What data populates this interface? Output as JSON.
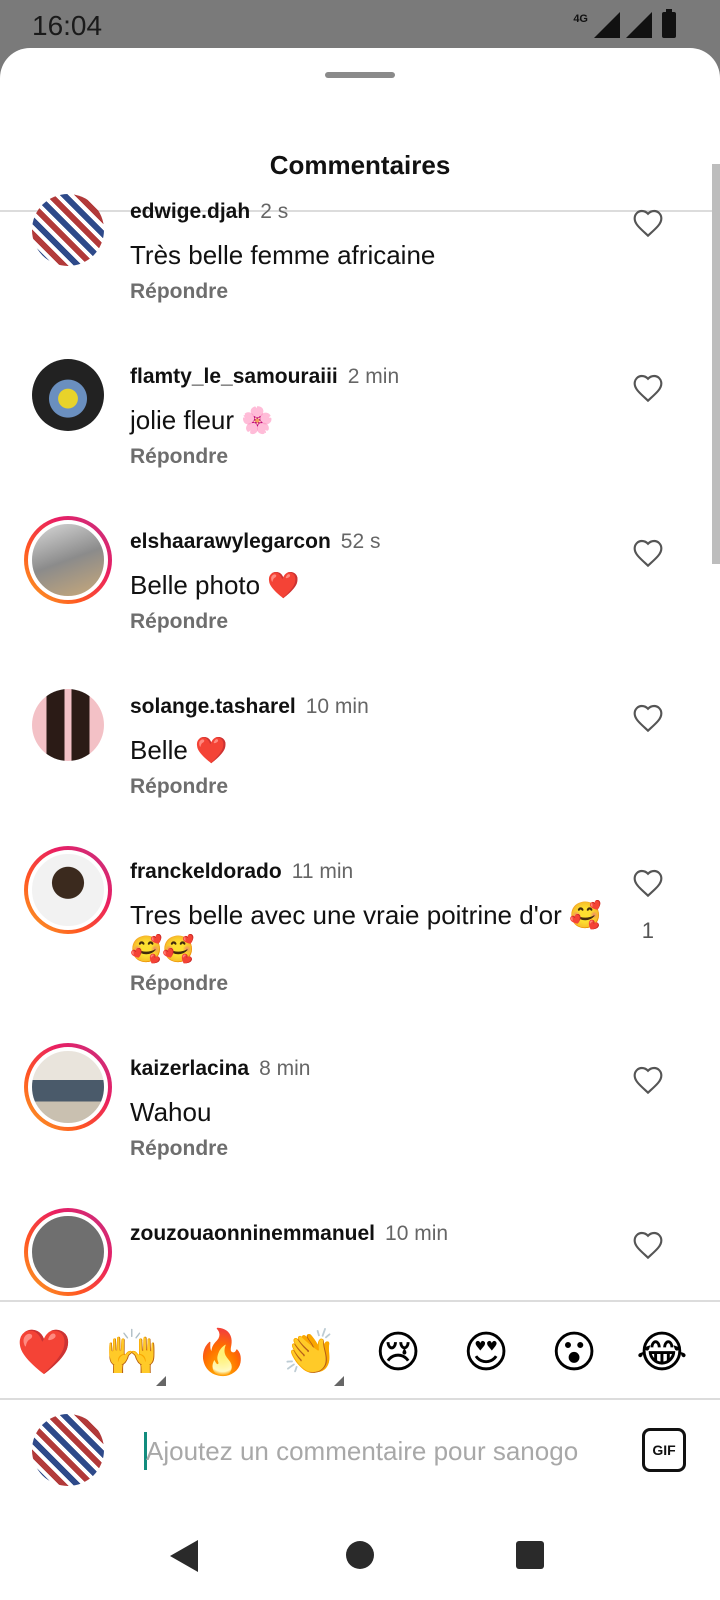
{
  "status_bar": {
    "time": "16:04",
    "network": "4G"
  },
  "sheet": {
    "title": "Commentaires"
  },
  "comments": [
    {
      "username": "edwige.djah",
      "time": "2 s",
      "text": "Très belle femme africaine",
      "reply_label": "Répondre",
      "likes": "",
      "avatar_style": "pattern",
      "story_ring": false
    },
    {
      "username": "flamty_le_samouraiii",
      "time": "2 min",
      "text": "jolie fleur 🌸",
      "reply_label": "Répondre",
      "likes": "",
      "avatar_style": "dark",
      "story_ring": false
    },
    {
      "username": "elshaarawylegarcon",
      "time": "52 s",
      "text": "Belle photo ❤️",
      "reply_label": "Répondre",
      "likes": "",
      "avatar_style": "photo1",
      "story_ring": true
    },
    {
      "username": "solange.tasharel",
      "time": "10 min",
      "text": "Belle ❤️",
      "reply_label": "Répondre",
      "likes": "",
      "avatar_style": "photo2",
      "story_ring": false
    },
    {
      "username": "franckeldorado",
      "time": "11 min",
      "text": "Tres belle avec une vraie poitrine d'or 🥰🥰🥰",
      "reply_label": "Répondre",
      "likes": "1",
      "avatar_style": "photo3",
      "story_ring": true
    },
    {
      "username": "kaizerlacina",
      "time": "8 min",
      "text": "Wahou",
      "reply_label": "Répondre",
      "likes": "",
      "avatar_style": "photo4",
      "story_ring": true
    },
    {
      "username": "zouzouaonninemmanuel",
      "time": "10 min",
      "text": "",
      "reply_label": "",
      "likes": "",
      "avatar_style": "grey",
      "story_ring": true
    }
  ],
  "emoji_bar": [
    {
      "emoji": "❤️",
      "name": "red-heart",
      "has_variants": false
    },
    {
      "emoji": "🙌",
      "name": "raising-hands",
      "has_variants": true
    },
    {
      "emoji": "🔥",
      "name": "fire",
      "has_variants": false
    },
    {
      "emoji": "👏",
      "name": "clapping-hands",
      "has_variants": true
    },
    {
      "emoji": "😢",
      "name": "crying-face",
      "has_variants": false
    },
    {
      "emoji": "😍",
      "name": "heart-eyes",
      "has_variants": false
    },
    {
      "emoji": "😮",
      "name": "surprised-face",
      "has_variants": false
    },
    {
      "emoji": "😂",
      "name": "tears-of-joy",
      "has_variants": false
    }
  ],
  "composer": {
    "placeholder": "Ajoutez un commentaire pour sanogo",
    "value": "",
    "gif_label": "GIF"
  },
  "colors": {
    "accent_cursor": "#128c7e",
    "story_ring": [
      "#f9a825",
      "#ff5722",
      "#e91e63",
      "#c13584"
    ]
  }
}
